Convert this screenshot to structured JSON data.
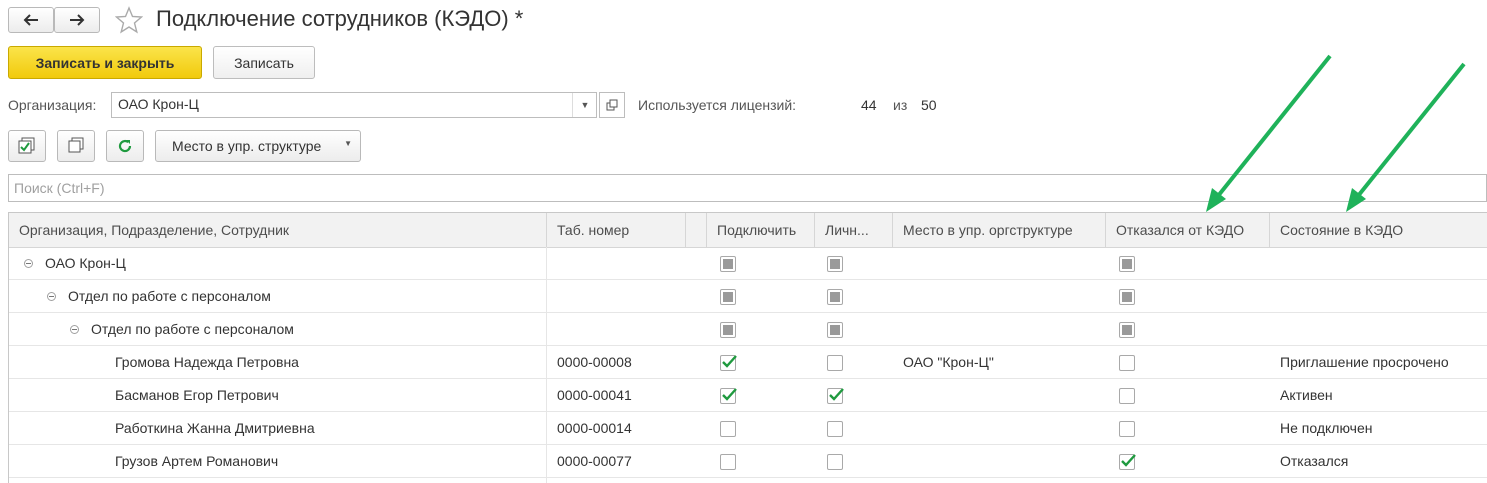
{
  "window": {
    "title": "Подключение сотрудников (КЭДО) *"
  },
  "toolbar": {
    "save_close_label": "Записать и закрыть",
    "save_label": "Записать",
    "place_menu_label": "Место в упр. структуре"
  },
  "form": {
    "org_label": "Организация:",
    "org_value": "ОАО Крон-Ц",
    "license_label": "Используется лицензий:",
    "license_used": "44",
    "license_of": "из",
    "license_total": "50"
  },
  "search": {
    "placeholder": "Поиск (Ctrl+F)"
  },
  "table": {
    "columns": [
      "Организация, Подразделение, Сотрудник",
      "Таб. номер",
      "",
      "Подключить",
      "Личн...",
      "Место в упр. оргструктуре",
      "Отказался от КЭДО",
      "Состояние в КЭДО"
    ],
    "rows": [
      {
        "name": "ОАО Крон-Ц",
        "tab": "",
        "connect": "partial",
        "personal": "partial",
        "place": "",
        "refused": "partial",
        "state": ""
      },
      {
        "name": "Отдел по работе с персоналом",
        "tab": "",
        "connect": "partial",
        "personal": "partial",
        "place": "",
        "refused": "partial",
        "state": ""
      },
      {
        "name": "Отдел по работе с персоналом",
        "tab": "",
        "connect": "partial",
        "personal": "partial",
        "place": "",
        "refused": "partial",
        "state": ""
      },
      {
        "name": "Громова Надежда Петровна",
        "tab": "0000-00008",
        "connect": "checked",
        "personal": "unchecked",
        "place": "ОАО \"Крон-Ц\"",
        "refused": "unchecked",
        "state": "Приглашение просрочено"
      },
      {
        "name": "Басманов Егор Петрович",
        "tab": "0000-00041",
        "connect": "checked",
        "personal": "checked",
        "place": "",
        "refused": "unchecked",
        "state": "Активен"
      },
      {
        "name": "Работкина Жанна Дмитриевна",
        "tab": "0000-00014",
        "connect": "unchecked",
        "personal": "unchecked",
        "place": "",
        "refused": "unchecked",
        "state": "Не подключен"
      },
      {
        "name": "Грузов Артем Романович",
        "tab": "0000-00077",
        "connect": "unchecked",
        "personal": "unchecked",
        "place": "",
        "refused": "checked",
        "state": "Отказался"
      }
    ]
  },
  "colors": {
    "accent_yellow": "#f5d31d",
    "check_green": "#1f9a3f",
    "annotation_arrow": "#1fb25a"
  }
}
